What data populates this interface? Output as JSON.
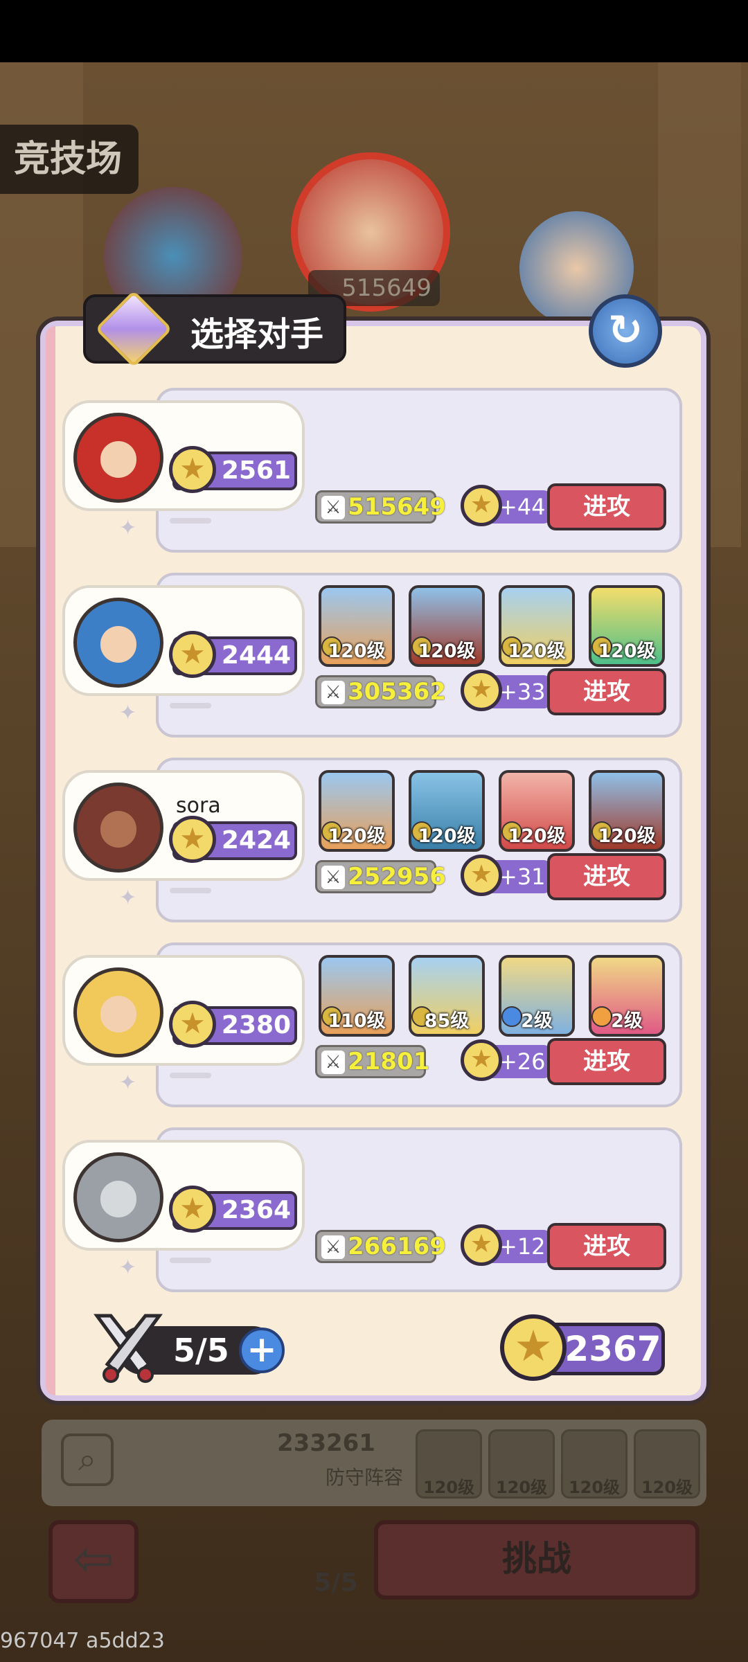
{
  "background": {
    "mode_label": "竞技场",
    "top_power": "515649",
    "defense_power": "233261",
    "defense_label": "防守阵容",
    "defense_heroes": [
      "120级",
      "120级",
      "120级",
      "120级"
    ],
    "challenge_label": "挑战",
    "attempts": "5/5",
    "build_id": "967047 a5dd23"
  },
  "modal": {
    "title": "选择对手",
    "refresh_glyph": "↻",
    "attack_label": "进攻",
    "opponents": [
      {
        "name": "",
        "rating": "2561",
        "power": "515649",
        "gain": "+44",
        "heroes": []
      },
      {
        "name": "",
        "rating": "2444",
        "power": "305362",
        "gain": "+33",
        "heroes": [
          "120级",
          "120级",
          "120级",
          "120级"
        ]
      },
      {
        "name": "sora",
        "rating": "2424",
        "power": "252956",
        "gain": "+31",
        "heroes": [
          "120级",
          "120级",
          "120级",
          "120级"
        ]
      },
      {
        "name": "",
        "rating": "2380",
        "power": "21801",
        "gain": "+26",
        "heroes": [
          "110级",
          "85级",
          "2级",
          "2级"
        ]
      },
      {
        "name": "",
        "rating": "2364",
        "power": "266169",
        "gain": "+12",
        "heroes": []
      }
    ],
    "footer": {
      "attempts": "5/5",
      "add_glyph": "+",
      "my_rating": "2367"
    }
  },
  "colors": {
    "attack_button": "#d95560",
    "rating_pill": "#8b6ad0",
    "power_text": "#f6ef3b",
    "panel": "#f9ecd8"
  }
}
